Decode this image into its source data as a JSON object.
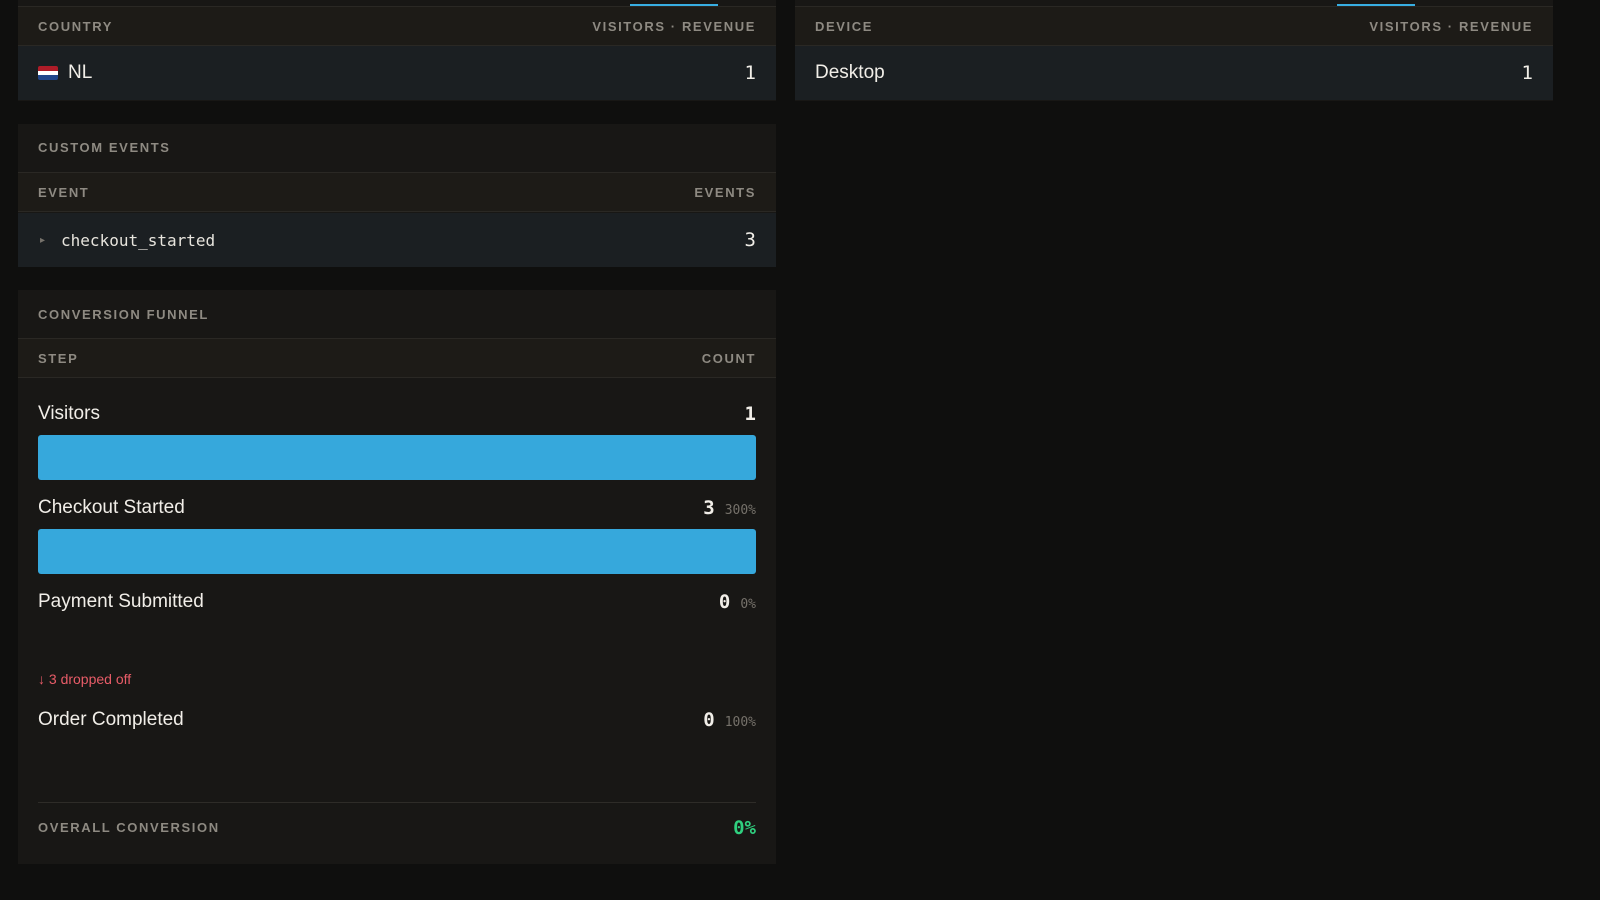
{
  "country_card": {
    "col_left": "COUNTRY",
    "col_right": "VISITORS · REVENUE",
    "rows": [
      {
        "flag": "netherlands-flag",
        "label": "NL",
        "value": "1"
      }
    ]
  },
  "device_card": {
    "col_left": "DEVICE",
    "col_right": "VISITORS · REVENUE",
    "rows": [
      {
        "label": "Desktop",
        "value": "1"
      }
    ]
  },
  "custom_events": {
    "title": "CUSTOM EVENTS",
    "col_left": "EVENT",
    "col_right": "EVENTS",
    "rows": [
      {
        "label": "checkout_started",
        "value": "3"
      }
    ]
  },
  "funnel": {
    "title": "CONVERSION FUNNEL",
    "col_left": "STEP",
    "col_right": "COUNT",
    "steps": [
      {
        "label": "Visitors",
        "count": "1",
        "pct": "",
        "fill": 1.0
      },
      {
        "label": "Checkout Started",
        "count": "3",
        "pct": "300%",
        "fill": 1.0
      },
      {
        "label": "Payment Submitted",
        "count": "0",
        "pct": "0%",
        "fill": 0
      },
      {
        "label": "Order Completed",
        "count": "0",
        "pct": "100%",
        "fill": 0
      }
    ],
    "dropoff": "↓ 3 dropped off",
    "overall_label": "OVERALL CONVERSION",
    "overall_value": "0%"
  },
  "colors": {
    "accent": "#36a8dc",
    "success": "#2fd07f",
    "danger": "#e85c68"
  }
}
